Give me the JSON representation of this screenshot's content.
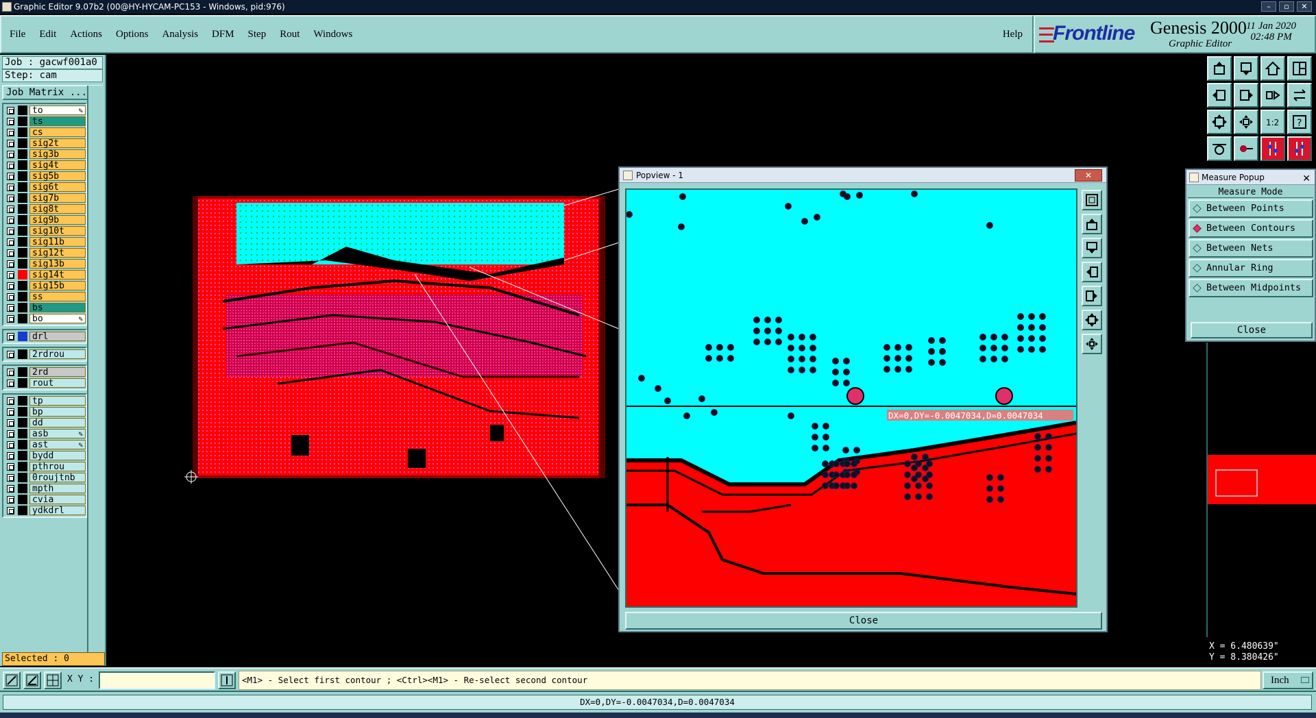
{
  "window": {
    "title": "Graphic Editor 9.07b2 (00@HY-HYCAM-PC153 - Windows, pid:976)",
    "controls": [
      "–",
      "▫",
      "✕"
    ]
  },
  "menu": {
    "items": [
      "File",
      "Edit",
      "Actions",
      "Options",
      "Analysis",
      "DFM",
      "Step",
      "Rout",
      "Windows"
    ],
    "help": "Help"
  },
  "brand": {
    "logo": "Frontline",
    "product": "Genesis 2000",
    "subtitle": "Graphic Editor",
    "date": "11 Jan 2020",
    "time": "02:48 PM"
  },
  "job": {
    "job": "Job : gacwf001a0",
    "step": "Step: cam",
    "matrix_button": "Job Matrix ..."
  },
  "layers": {
    "group1": [
      {
        "name": "to",
        "style": "white",
        "pen": true
      },
      {
        "name": "ts",
        "style": "teal"
      },
      {
        "name": "cs",
        "style": "orange"
      },
      {
        "name": "sig2t",
        "style": "orange"
      },
      {
        "name": "sig3b",
        "style": "orange"
      },
      {
        "name": "sig4t",
        "style": "orange"
      },
      {
        "name": "sig5b",
        "style": "orange"
      },
      {
        "name": "sig6t",
        "style": "orange"
      },
      {
        "name": "sig7b",
        "style": "orange"
      },
      {
        "name": "sig8t",
        "style": "orange"
      },
      {
        "name": "sig9b",
        "style": "orange"
      },
      {
        "name": "sig10t",
        "style": "orange"
      },
      {
        "name": "sig11b",
        "style": "orange"
      },
      {
        "name": "sig12t",
        "style": "orange"
      },
      {
        "name": "sig13b",
        "style": "orange"
      },
      {
        "name": "sig14t",
        "style": "orange",
        "swatch": "red"
      },
      {
        "name": "sig15b",
        "style": "orange"
      },
      {
        "name": "ss",
        "style": "orange"
      },
      {
        "name": "bs",
        "style": "teal"
      },
      {
        "name": "bo",
        "style": "white",
        "pen": true
      }
    ],
    "group2": [
      {
        "name": "drl",
        "style": "gray",
        "swatch": "blue"
      }
    ],
    "group3": [
      {
        "name": "2rdrou",
        "style": "cyan"
      }
    ],
    "group4": [
      {
        "name": "2rd",
        "style": "gray"
      },
      {
        "name": "rout",
        "style": "cyan"
      }
    ],
    "group5": [
      {
        "name": "tp",
        "style": "cyan"
      },
      {
        "name": "bp",
        "style": "cyan"
      },
      {
        "name": "dd",
        "style": "cyan"
      },
      {
        "name": "asb",
        "style": "cyan",
        "pen": true
      },
      {
        "name": "ast",
        "style": "cyan",
        "pen": true
      },
      {
        "name": "bydd",
        "style": "cyan"
      },
      {
        "name": "pthrou",
        "style": "cyan"
      },
      {
        "name": "0roujtnb",
        "style": "cyan"
      },
      {
        "name": "mpth",
        "style": "cyan"
      },
      {
        "name": "cvia",
        "style": "cyan"
      },
      {
        "name": "ydkdrl",
        "style": "cyan"
      }
    ],
    "pen_glyph": "✎"
  },
  "selected": "Selected : 0",
  "popview": {
    "title": "Popview - 1",
    "close_x": "✕",
    "measure_label": "DX=0,DY=-0.0047034,D=0.0047034",
    "close_button": "Close"
  },
  "measure_popup": {
    "title": "Measure Popup",
    "close_x": "✕",
    "heading": "Measure Mode",
    "options": [
      "Between Points",
      "Between Contours",
      "Between Nets",
      "Annular Ring",
      "Between Midpoints"
    ],
    "selected_option": "Between Contours",
    "close_button": "Close"
  },
  "coords": {
    "x": "X = 6.480639\"",
    "y": "Y = 8.380426\""
  },
  "bottombar": {
    "xy_label": "X Y :",
    "xy_value": "",
    "prompt": "<M1> - Select first contour ; <Ctrl><M1> - Re-select second contour",
    "unit": "Inch"
  },
  "status": "DX=0,DY=-0.0047034,D=0.0047034",
  "colors": {
    "panel": "#9fd5d1",
    "layer_active": "#fdc553",
    "copper": "#ff0000",
    "soldermask": "#00ffff",
    "accent_magenta": "#e0306a"
  }
}
